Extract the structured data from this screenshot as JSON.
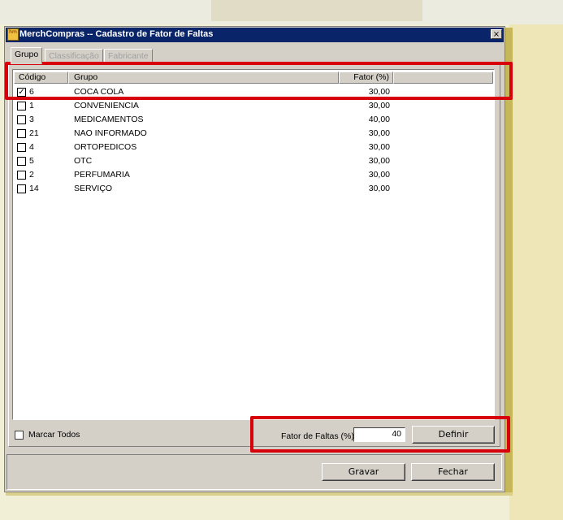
{
  "window": {
    "title": "MerchCompras -- Cadastro de Fator de Faltas",
    "icon_text": "hm",
    "close_symbol": "×"
  },
  "tabs": [
    {
      "label": "Grupo",
      "state": "active"
    },
    {
      "label": "Classificação",
      "state": "disabled"
    },
    {
      "label": "Fabricante",
      "state": "disabled"
    }
  ],
  "grid": {
    "columns": [
      "Código",
      "Grupo",
      "Fator (%)"
    ],
    "rows": [
      {
        "checked": true,
        "codigo": "6",
        "grupo": "COCA COLA",
        "fator": "30,00"
      },
      {
        "checked": false,
        "codigo": "1",
        "grupo": "CONVENIENCIA",
        "fator": "30,00"
      },
      {
        "checked": false,
        "codigo": "3",
        "grupo": "MEDICAMENTOS",
        "fator": "40,00"
      },
      {
        "checked": false,
        "codigo": "21",
        "grupo": "NAO INFORMADO",
        "fator": "30,00"
      },
      {
        "checked": false,
        "codigo": "4",
        "grupo": "ORTOPEDICOS",
        "fator": "30,00"
      },
      {
        "checked": false,
        "codigo": "5",
        "grupo": "OTC",
        "fator": "30,00"
      },
      {
        "checked": false,
        "codigo": "2",
        "grupo": "PERFUMARIA",
        "fator": "30,00"
      },
      {
        "checked": false,
        "codigo": "14",
        "grupo": "SERVIÇO",
        "fator": "30,00"
      }
    ]
  },
  "controls": {
    "marcar_todos_label": "Marcar Todos",
    "fator_label": "Fator de Faltas (%)",
    "fator_value": "40",
    "definir_label": "Definir",
    "gravar_label": "Gravar",
    "fechar_label": "Fechar"
  },
  "colors": {
    "titlebar": "#0a246a",
    "face": "#d4d0c8",
    "highlight": "#d8000b"
  }
}
